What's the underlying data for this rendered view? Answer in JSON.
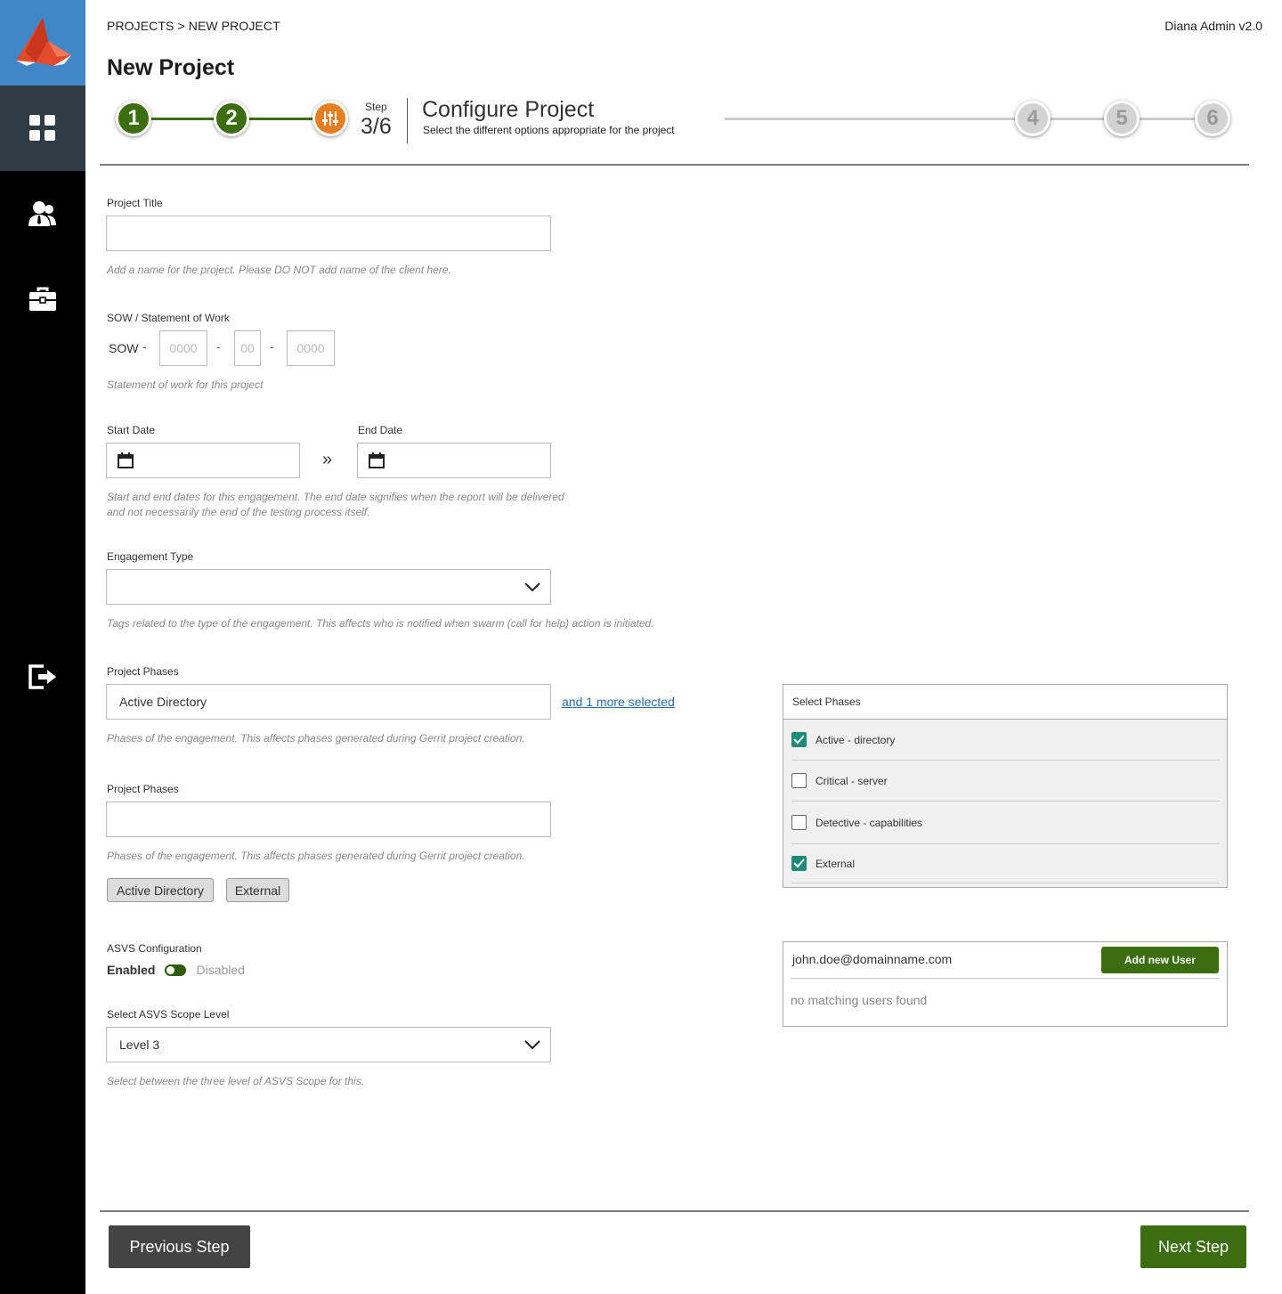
{
  "app": {
    "version": "Diana Admin v2.0"
  },
  "breadcrumb": "PROJECTS > NEW PROJECT",
  "page_title": "New Project",
  "stepper": {
    "steps": [
      {
        "label": "1",
        "state": "done"
      },
      {
        "label": "2",
        "state": "done"
      },
      {
        "label": "",
        "state": "current",
        "icon": "sliders-icon"
      },
      {
        "label": "4",
        "state": "todo"
      },
      {
        "label": "5",
        "state": "todo"
      },
      {
        "label": "6",
        "state": "todo"
      }
    ],
    "step_word": "Step",
    "step_count": "3/6",
    "title": "Configure Project",
    "subtitle": "Select the different options appropriate for the project",
    "colors": {
      "done": "#3c6e0f",
      "current": "#e67e22",
      "todo": "#d3d3d3"
    }
  },
  "sidebar": {
    "items": [
      {
        "icon": "dashboard-icon",
        "active": true
      },
      {
        "icon": "users-icon",
        "active": false
      },
      {
        "icon": "briefcase-icon",
        "active": false
      },
      {
        "icon": "logout-icon",
        "active": false
      }
    ]
  },
  "form": {
    "project_title": {
      "label": "Project Title",
      "value": "",
      "hint": "Add a name for the project. Please DO NOT add name of the client here."
    },
    "sow": {
      "label": "SOW / Statement of Work",
      "prefix": "SOW",
      "separator": "-",
      "placeholders": [
        "0000",
        "00",
        "0000"
      ],
      "hint": "Statement of work for this project"
    },
    "dates": {
      "start_label": "Start Date",
      "end_label": "End Date",
      "range_symbol": "»",
      "hint_line1": "Start and end dates for this engagement. The end date signifies when the report will be delivered",
      "hint_line2": "and not necessarily the end of the testing process itself."
    },
    "engagement_type": {
      "label": "Engagement Type",
      "value": "",
      "hint": "Tags related to the type of the engagement. This affects who is notified when swarm (call for help) action is initiated."
    },
    "project_phases_1": {
      "label": "Project Phases",
      "value": "Active Directory",
      "more_link": "and 1 more selected",
      "hint": "Phases of the engagement. This affects phases generated during Gerrit project creation."
    },
    "project_phases_2": {
      "label": "Project Phases",
      "value": "",
      "hint": "Phases of the engagement. This affects phases generated during Gerrit project creation.",
      "tags": [
        "Active Directory",
        "External"
      ]
    },
    "asvs": {
      "label": "ASVS Configuration",
      "enabled_label": "Enabled",
      "disabled_label": "Disabled",
      "enabled": true
    },
    "asvs_scope": {
      "label": "Select ASVS Scope Level",
      "value": "Level 3",
      "hint": "Select between the three level of ASVS Scope for this."
    }
  },
  "phase_panel": {
    "header": "Select Phases",
    "items": [
      {
        "label": "Active - directory",
        "checked": true
      },
      {
        "label": "Critical - server",
        "checked": false
      },
      {
        "label": "Detective - capabilities",
        "checked": false
      },
      {
        "label": "External",
        "checked": true
      }
    ]
  },
  "user_panel": {
    "email": "john.doe@domainname.com",
    "add_button": "Add new User",
    "empty_text": "no matching users found"
  },
  "footer": {
    "prev_label": "Previous Step",
    "next_label": "Next Step"
  }
}
